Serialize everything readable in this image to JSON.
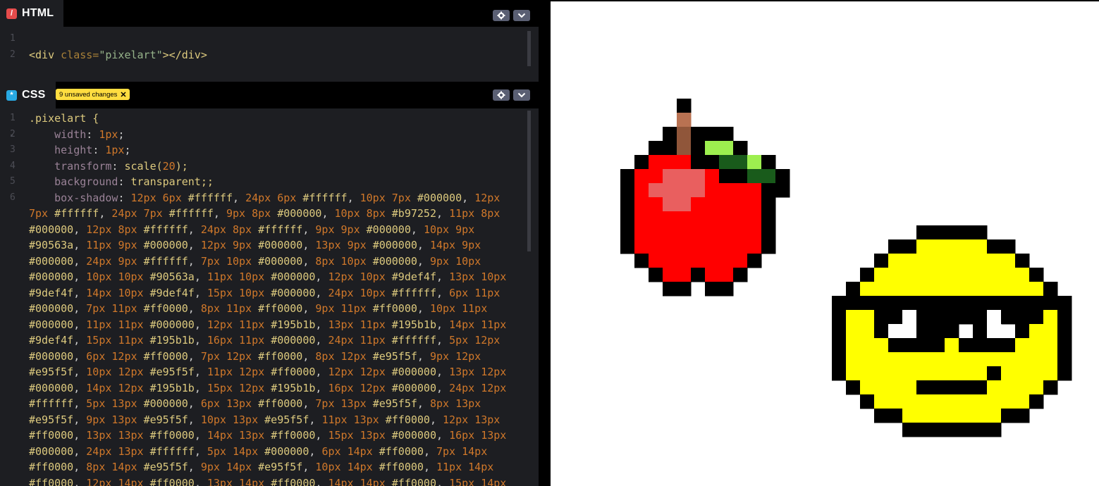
{
  "html_pane": {
    "title": "HTML",
    "badge_color": "#e54b4b",
    "line_numbers": [
      "1",
      "2"
    ],
    "code": {
      "open_tag": "<div",
      "attr_name": " class=",
      "attr_value": "\"pixelart\"",
      "close_tag": "></div>"
    }
  },
  "css_pane": {
    "title": "CSS",
    "badge_color": "#28a9e3",
    "unsaved_label": "9 unsaved changes",
    "line_numbers": [
      "1",
      "2",
      "3",
      "4",
      "5",
      "6"
    ],
    "selector": ".pixelart {",
    "rules": [
      {
        "prop": "width",
        "value": "1px"
      },
      {
        "prop": "height",
        "value": "1px"
      },
      {
        "prop": "transform",
        "fn": "scale(",
        "num": "20",
        "end": ");"
      },
      {
        "prop": "background",
        "value": "transparent;;"
      }
    ],
    "box_shadow_prop": "box-shadow",
    "box_shadow": "12px 6px #ffffff, 24px 6px #ffffff, 10px 7px #000000, 12px 7px #ffffff, 24px 7px #ffffff, 9px 8px #000000, 10px 8px #b97252, 11px 8px #000000, 12px 8px #ffffff, 24px 8px #ffffff, 9px 9px #000000, 10px 9px #90563a, 11px 9px #000000, 12px 9px #000000, 13px 9px #000000, 14px 9px #000000, 24px 9px #ffffff, 7px 10px #000000, 8px 10px #000000, 9px 10px #000000, 10px 10px #90563a, 11px 10px #000000, 12px 10px #9def4f, 13px 10px #9def4f, 14px 10px #9def4f, 15px 10px #000000, 24px 10px #ffffff, 6px 11px #000000, 7px 11px #ff0000, 8px 11px #ff0000, 9px 11px #ff0000, 10px 11px #000000, 11px 11px #000000, 12px 11px #195b1b, 13px 11px #195b1b, 14px 11px #9def4f, 15px 11px #195b1b, 16px 11px #000000, 24px 11px #ffffff, 5px 12px #000000, 6px 12px #ff0000, 7px 12px #ff0000, 8px 12px #e95f5f, 9px 12px #e95f5f, 10px 12px #e95f5f, 11px 12px #ff0000, 12px 12px #000000, 13px 12px #000000, 14px 12px #195b1b, 15px 12px #195b1b, 16px 12px #000000, 24px 12px #ffffff, 5px 13px #000000, 6px 13px #ff0000, 7px 13px #e95f5f, 8px 13px #e95f5f, 9px 13px #e95f5f, 10px 13px #e95f5f, 11px 13px #ff0000, 12px 13px #ff0000, 13px 13px #ff0000, 14px 13px #ff0000, 15px 13px #000000, 16px 13px #000000, 24px 13px #ffffff, 5px 14px #000000, 6px 14px #ff0000, 7px 14px #ff0000, 8px 14px #e95f5f, 9px 14px #e95f5f, 10px 14px #ff0000, 11px 14px #ff0000, 12px 14px #ff0000, 13px 14px #ff0000, 14px 14px #ff0000, 15px 14px"
  },
  "colors": {
    "editor_bg": "#1d1e22",
    "header_bg": "#000000",
    "black": "#000000",
    "red": "#ff0000",
    "highlight": "#e95f5f",
    "stem_light": "#b97252",
    "stem_dark": "#90563a",
    "leaf_light": "#9def4f",
    "leaf_dark": "#195b1b",
    "yellow": "#ffff00",
    "white": "#ffffff"
  },
  "icons": {
    "settings": "gear-icon",
    "collapse": "chevron-down-icon",
    "dismiss": "close-icon"
  },
  "preview": {
    "apple_rows": [
      "....#......",
      "....S......",
      "...#D###...",
      "..##D#LL#..",
      ".#RRR##GGL#",
      "#RRHHHR##GG#",
      "#RHHHHRRRR##",
      "#RRHHRRRRR#",
      "#RRRRRRRRR#",
      "#RRRRRRRRR#",
      "#RRRRRRRRR#",
      ".#RRRRRRR#.",
      "..#RR#RR#..",
      "...##.##..."
    ],
    "smiley_rows": [
      "......#####......",
      "....##YYYYY##....",
      "...#YYYYYYYYY#...",
      "..#YYYYYYYYYYY#..",
      ".#YYYYYYYYYYYYY#.",
      "#################",
      "#YY##W#####W###Y#",
      "#YY#W.###.#W.#YY#",
      "#YYY####Y####YYY#",
      "#YYYYYYYYYYYYYYY#",
      "#YYYYYYYYYY#YYYY#",
      ".#YYYY#####YYYY#.",
      "..#YYYYYYYYYYY#..",
      "...##YYYYYYY##...",
      ".....#######....."
    ]
  }
}
